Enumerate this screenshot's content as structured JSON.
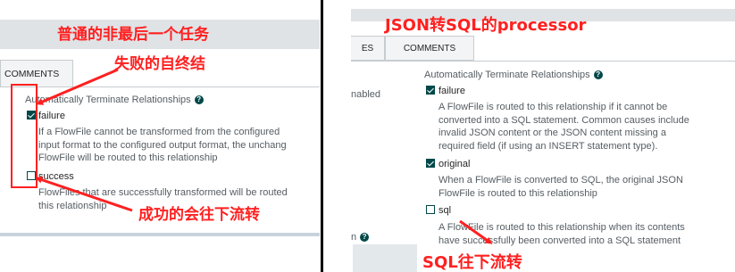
{
  "left": {
    "annotation_title": "普通的非最后一个任务",
    "tab_label": "COMMENTS",
    "annotation_fail": "失败的自终结",
    "section_title": "Automatically Terminate Relationships",
    "relationships": [
      {
        "name": "failure",
        "checked": true,
        "desc_lines": [
          "If a FlowFile cannot be transformed from the configured",
          "input format to the configured output format, the unchang",
          "FlowFile will be routed to this relationship"
        ]
      },
      {
        "name": "success",
        "checked": false,
        "desc_lines": [
          "FlowFiles that are successfully transformed will be routed",
          "this relationship"
        ]
      }
    ],
    "annotation_success": "成功的会往下流转"
  },
  "right": {
    "annotation_title": "JSON转SQL的processor",
    "tabs": [
      "ES",
      "COMMENTS"
    ],
    "left_fragment_1": "nabled",
    "left_fragment_2": "n",
    "section_title": "Automatically Terminate Relationships",
    "relationships": [
      {
        "name": "failure",
        "checked": true,
        "desc_lines": [
          "A FlowFile is routed to this relationship if it cannot be",
          "converted into a SQL statement. Common causes include",
          "invalid JSON content or the JSON content missing a",
          "required field (if using an INSERT statement type)."
        ]
      },
      {
        "name": "original",
        "checked": true,
        "desc_lines": [
          "When a FlowFile is converted to SQL, the original JSON",
          "FlowFile is routed to this relationship"
        ]
      },
      {
        "name": "sql",
        "checked": false,
        "desc_lines": [
          "A FlowFile is routed to this relationship when its contents",
          "have successfully been converted into a SQL statement"
        ]
      }
    ],
    "annotation_sql": "SQL往下流转"
  },
  "colors": {
    "annotation": "#ff2020",
    "checkbox": "#004849",
    "header": "#dfe3e6"
  }
}
